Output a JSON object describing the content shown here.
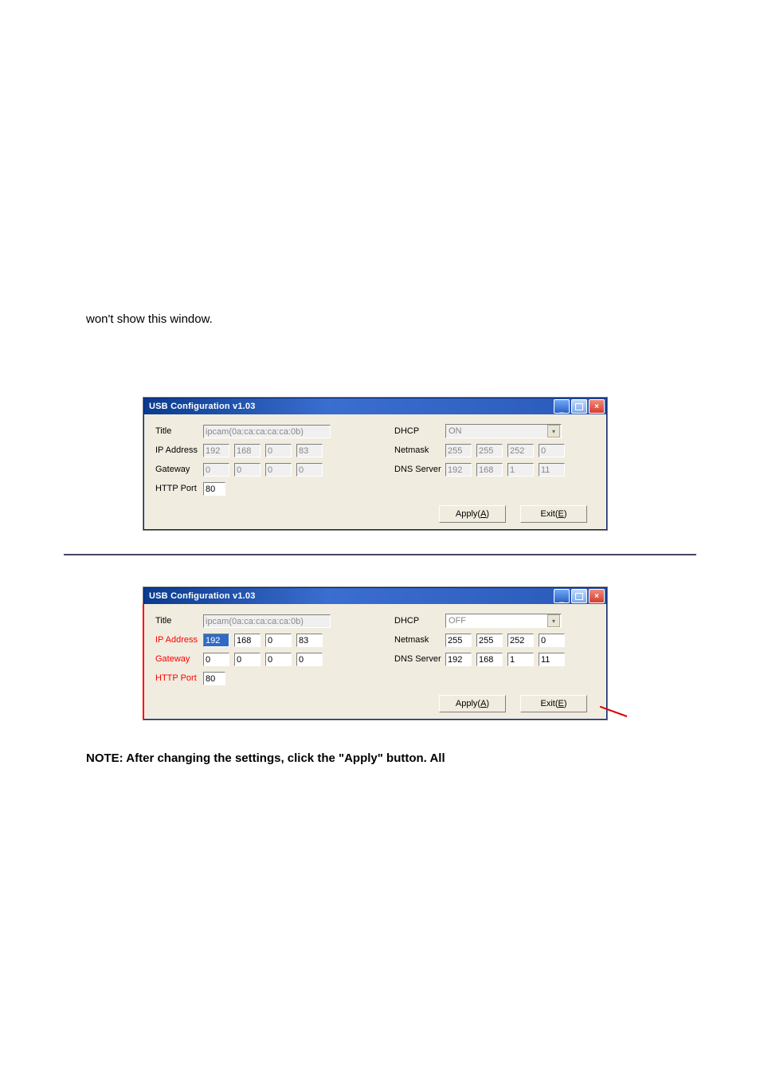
{
  "text_line": "won't show this window.",
  "note": "NOTE: After changing the settings, click the \"Apply\" button. All",
  "window1": {
    "title": "USB Configuration v1.03",
    "labels": {
      "title": "Title",
      "ip": "IP Address",
      "gateway": "Gateway",
      "httpport": "HTTP Port",
      "dhcp": "DHCP",
      "netmask": "Netmask",
      "dns": "DNS Server"
    },
    "fields": {
      "title": "ipcam(0a:ca:ca:ca:ca:0b)",
      "ip": [
        "192",
        "168",
        "0",
        "83"
      ],
      "gateway": [
        "0",
        "0",
        "0",
        "0"
      ],
      "httpport": "80",
      "dhcp": "ON",
      "netmask": [
        "255",
        "255",
        "252",
        "0"
      ],
      "dns": [
        "192",
        "168",
        "1",
        "11"
      ]
    },
    "buttons": {
      "apply": "Apply(",
      "apply_u": "A",
      "apply_end": ")",
      "exit": "Exit(",
      "exit_u": "E",
      "exit_end": ")"
    }
  },
  "window2": {
    "title": "USB Configuration v1.03",
    "labels": {
      "title": "Title",
      "ip": "IP Address",
      "gateway": "Gateway",
      "httpport": "HTTP Port",
      "dhcp": "DHCP",
      "netmask": "Netmask",
      "dns": "DNS Server"
    },
    "fields": {
      "title": "ipcam(0a:ca:ca:ca:ca:0b)",
      "ip": [
        "192",
        "168",
        "0",
        "83"
      ],
      "gateway": [
        "0",
        "0",
        "0",
        "0"
      ],
      "httpport": "80",
      "dhcp": "OFF",
      "netmask": [
        "255",
        "255",
        "252",
        "0"
      ],
      "dns": [
        "192",
        "168",
        "1",
        "11"
      ]
    },
    "buttons": {
      "apply": "Apply(",
      "apply_u": "A",
      "apply_end": ")",
      "exit": "Exit(",
      "exit_u": "E",
      "exit_end": ")"
    }
  }
}
